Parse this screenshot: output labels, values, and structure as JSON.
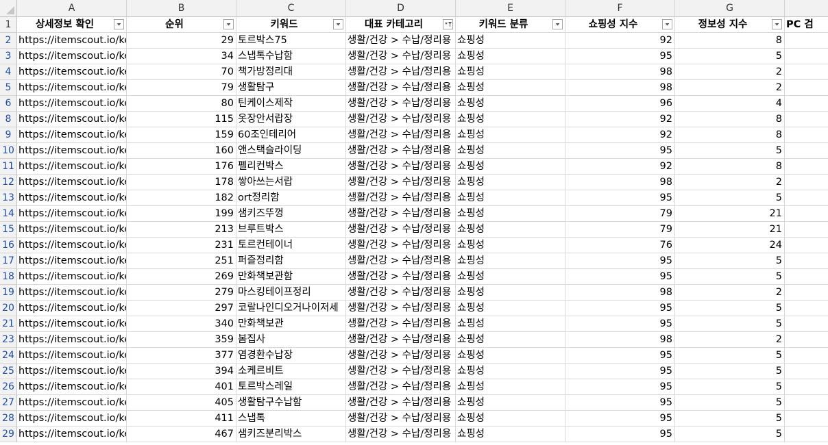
{
  "columns": [
    {
      "letter": "A",
      "width": 160
    },
    {
      "letter": "B",
      "width": 160
    },
    {
      "letter": "C",
      "width": 160
    },
    {
      "letter": "D",
      "width": 160
    },
    {
      "letter": "E",
      "width": 160
    },
    {
      "letter": "F",
      "width": 160
    },
    {
      "letter": "G",
      "width": 160
    },
    {
      "letter": "",
      "width": 64
    }
  ],
  "header_row": {
    "row_number": "1",
    "cells": [
      "상세정보 확인",
      "순위",
      "키워드",
      "대표 카테고리",
      "키워드 분류",
      "쇼핑성 지수",
      "정보성 지수",
      "PC 검"
    ],
    "filters": [
      "dropdown",
      "dropdown",
      "dropdown",
      "filtered",
      "dropdown",
      "dropdown",
      "dropdown",
      ""
    ]
  },
  "icons": {
    "filter_dropdown": "chevron-down-icon",
    "filter_active": "funnel-icon"
  },
  "url_prefix": "https://itemscout.io/key",
  "category": "생활/건강 > 수납/정리용",
  "rows": [
    {
      "n": "2",
      "rank": "29",
      "keyword": "토르박스75",
      "type": "쇼핑성",
      "shop": "92",
      "info": "8"
    },
    {
      "n": "3",
      "rank": "34",
      "keyword": "스냅톡수납함",
      "type": "쇼핑성",
      "shop": "95",
      "info": "5"
    },
    {
      "n": "4",
      "rank": "70",
      "keyword": "책가방정리대",
      "type": "쇼핑성",
      "shop": "98",
      "info": "2"
    },
    {
      "n": "5",
      "rank": "79",
      "keyword": "생활탐구",
      "type": "쇼핑성",
      "shop": "98",
      "info": "2"
    },
    {
      "n": "6",
      "rank": "80",
      "keyword": "틴케이스제작",
      "type": "쇼핑성",
      "shop": "96",
      "info": "4"
    },
    {
      "n": "8",
      "rank": "115",
      "keyword": "옷장안서랍장",
      "type": "쇼핑성",
      "shop": "92",
      "info": "8"
    },
    {
      "n": "9",
      "rank": "159",
      "keyword": "60조인테리어",
      "type": "쇼핑성",
      "shop": "92",
      "info": "8"
    },
    {
      "n": "10",
      "rank": "160",
      "keyword": "앤스택슬라이딩",
      "type": "쇼핑성",
      "shop": "95",
      "info": "5"
    },
    {
      "n": "11",
      "rank": "176",
      "keyword": "펠리컨박스",
      "type": "쇼핑성",
      "shop": "92",
      "info": "8"
    },
    {
      "n": "12",
      "rank": "178",
      "keyword": "쌓아쓰는서랍",
      "type": "쇼핑성",
      "shop": "98",
      "info": "2"
    },
    {
      "n": "13",
      "rank": "182",
      "keyword": "ort정리함",
      "type": "쇼핑성",
      "shop": "95",
      "info": "5"
    },
    {
      "n": "14",
      "rank": "199",
      "keyword": "샘키즈뚜껑",
      "type": "쇼핑성",
      "shop": "79",
      "info": "21"
    },
    {
      "n": "15",
      "rank": "213",
      "keyword": "브루트박스",
      "type": "쇼핑성",
      "shop": "79",
      "info": "21"
    },
    {
      "n": "16",
      "rank": "231",
      "keyword": "토르컨테이너",
      "type": "쇼핑성",
      "shop": "76",
      "info": "24"
    },
    {
      "n": "17",
      "rank": "251",
      "keyword": "퍼즐정리함",
      "type": "쇼핑성",
      "shop": "95",
      "info": "5"
    },
    {
      "n": "18",
      "rank": "269",
      "keyword": "만화책보관함",
      "type": "쇼핑성",
      "shop": "95",
      "info": "5"
    },
    {
      "n": "19",
      "rank": "279",
      "keyword": "마스킹테이프정리",
      "type": "쇼핑성",
      "shop": "98",
      "info": "2"
    },
    {
      "n": "20",
      "rank": "297",
      "keyword": "코랄나인디오거나이저세",
      "type": "쇼핑성",
      "shop": "95",
      "info": "5"
    },
    {
      "n": "21",
      "rank": "340",
      "keyword": "만화책보관",
      "type": "쇼핑성",
      "shop": "95",
      "info": "5"
    },
    {
      "n": "23",
      "rank": "359",
      "keyword": "봄집사",
      "type": "쇼핑성",
      "shop": "98",
      "info": "2"
    },
    {
      "n": "24",
      "rank": "377",
      "keyword": "염경환수납장",
      "type": "쇼핑성",
      "shop": "95",
      "info": "5"
    },
    {
      "n": "25",
      "rank": "394",
      "keyword": "소케르비트",
      "type": "쇼핑성",
      "shop": "95",
      "info": "5"
    },
    {
      "n": "26",
      "rank": "401",
      "keyword": "토르박스레일",
      "type": "쇼핑성",
      "shop": "95",
      "info": "5"
    },
    {
      "n": "27",
      "rank": "405",
      "keyword": "생활탐구수납함",
      "type": "쇼핑성",
      "shop": "95",
      "info": "5"
    },
    {
      "n": "28",
      "rank": "411",
      "keyword": "스냅톡",
      "type": "쇼핑성",
      "shop": "95",
      "info": "5"
    },
    {
      "n": "29",
      "rank": "467",
      "keyword": "샘키즈분리박스",
      "type": "쇼핑성",
      "shop": "95",
      "info": "5"
    }
  ]
}
